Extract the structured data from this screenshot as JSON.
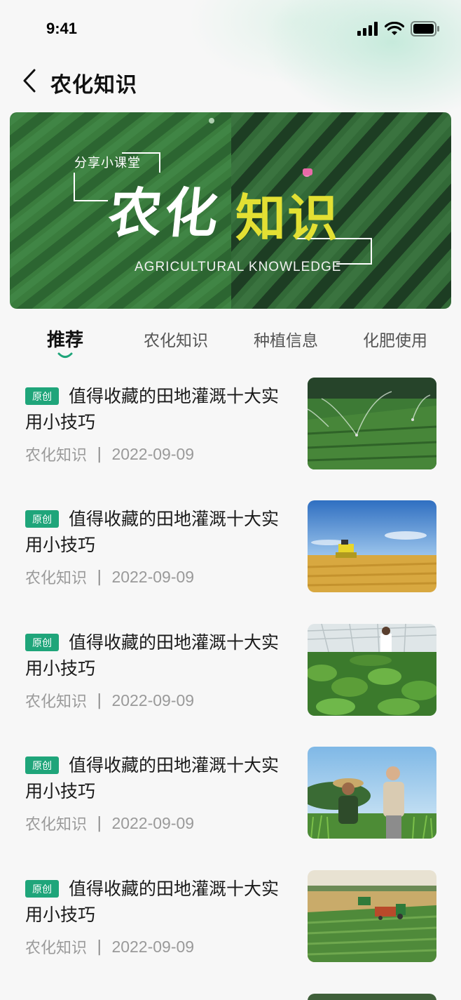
{
  "status_bar": {
    "time": "9:41",
    "icons": [
      "signal-icon",
      "wifi-icon",
      "battery-icon"
    ]
  },
  "nav": {
    "title": "农化知识",
    "back_icon": "chevron-left-icon"
  },
  "banner": {
    "subtitle": "分享小课堂",
    "title_left": "农化",
    "title_right": "知识",
    "title_en": "AGRICULTURAL KNOWLEDGE",
    "colors": {
      "left_bg": "#2f6b35",
      "right_bg": "#2a5a31",
      "accent_yellow": "#e3e033"
    }
  },
  "tabs": [
    {
      "label": "推荐",
      "active": true
    },
    {
      "label": "农化知识",
      "active": false
    },
    {
      "label": "种植信息",
      "active": false
    },
    {
      "label": "化肥使用",
      "active": false
    }
  ],
  "accent_color": "#1fa57a",
  "articles": [
    {
      "badge": "原创",
      "title": "值得收藏的田地灌溉十大实用小技巧",
      "category": "农化知识",
      "separator": "|",
      "date": "2022-09-09",
      "thumb": "irrigation-field-image"
    },
    {
      "badge": "原创",
      "title": "值得收藏的田地灌溉十大实用小技巧",
      "category": "农化知识",
      "separator": "|",
      "date": "2022-09-09",
      "thumb": "wheat-harvester-image"
    },
    {
      "badge": "原创",
      "title": "值得收藏的田地灌溉十大实用小技巧",
      "category": "农化知识",
      "separator": "|",
      "date": "2022-09-09",
      "thumb": "greenhouse-spinach-image"
    },
    {
      "badge": "原创",
      "title": "值得收藏的田地灌溉十大实用小技巧",
      "category": "农化知识",
      "separator": "|",
      "date": "2022-09-09",
      "thumb": "farmers-field-image"
    },
    {
      "badge": "原创",
      "title": "值得收藏的田地灌溉十大实用小技巧",
      "category": "农化知识",
      "separator": "|",
      "date": "2022-09-09",
      "thumb": "tractor-harvest-image"
    }
  ]
}
